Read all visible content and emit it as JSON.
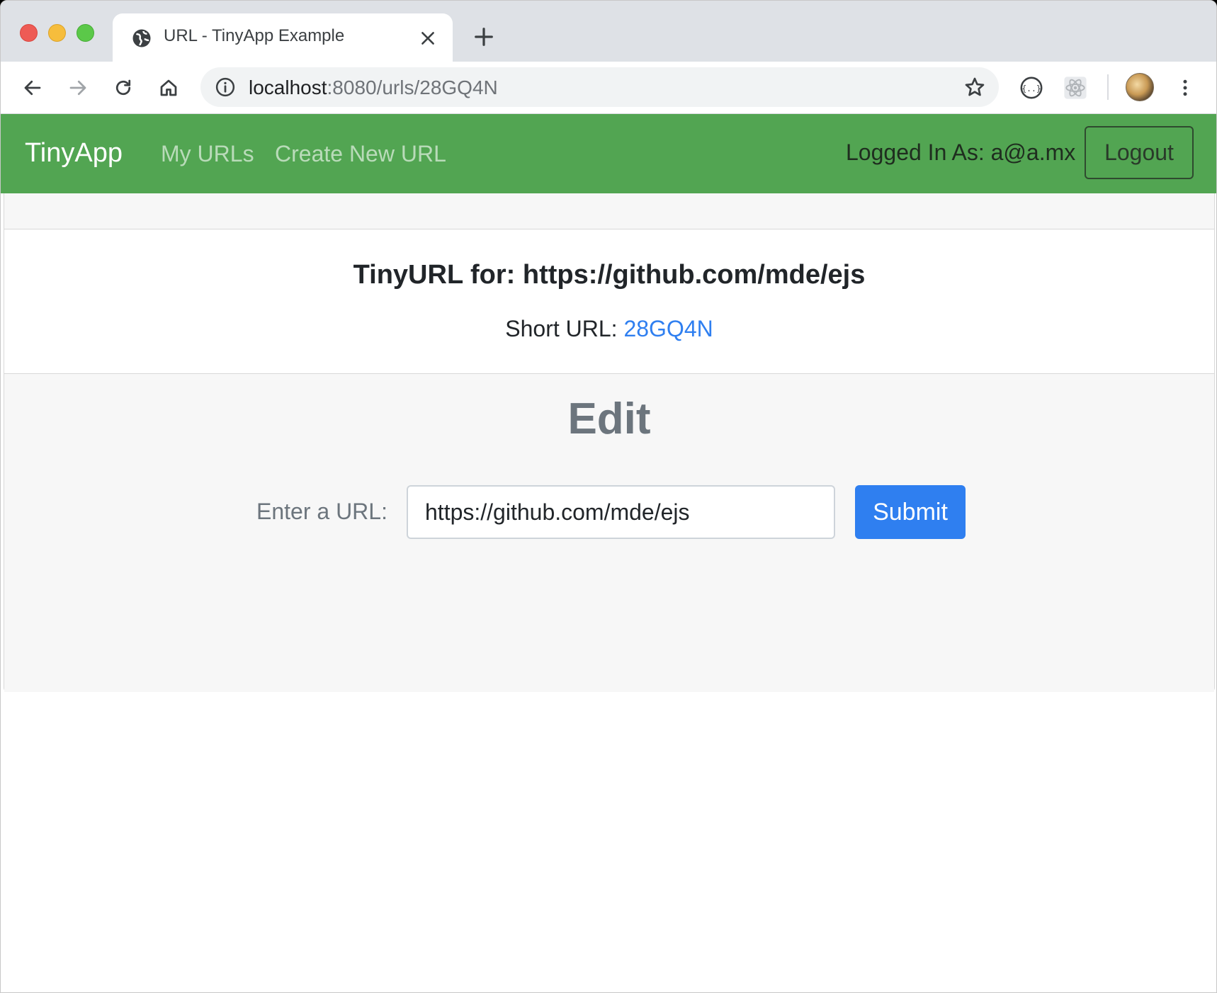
{
  "browser": {
    "tab_title": "URL - TinyApp Example",
    "url_host": "localhost",
    "url_path": ":8080/urls/28GQ4N"
  },
  "navbar": {
    "brand": "TinyApp",
    "links": [
      "My URLs",
      "Create New URL"
    ],
    "user_text": "Logged In As: a@a.mx",
    "logout_label": "Logout",
    "background_color": "#52a552"
  },
  "card": {
    "title": "TinyURL for: https://github.com/mde/ejs",
    "short_label": "Short URL:",
    "short_value": "28GQ4N",
    "link_color": "#2f7ff0"
  },
  "edit": {
    "heading": "Edit",
    "label": "Enter a URL:",
    "input_value": "https://github.com/mde/ejs",
    "submit_label": "Submit"
  }
}
